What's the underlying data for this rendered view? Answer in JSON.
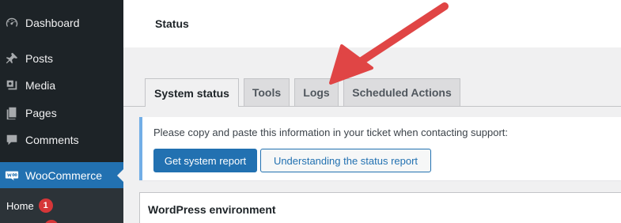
{
  "sidebar": {
    "items": [
      {
        "label": "Dashboard",
        "icon": "dashboard-icon"
      },
      {
        "label": "Posts",
        "icon": "pin-icon"
      },
      {
        "label": "Media",
        "icon": "media-icon"
      },
      {
        "label": "Pages",
        "icon": "pages-icon"
      },
      {
        "label": "Comments",
        "icon": "comment-icon"
      },
      {
        "label": "WooCommerce",
        "icon": "woocommerce-icon",
        "active": true
      }
    ],
    "submenu": {
      "home_label": "Home",
      "home_badge": "1"
    }
  },
  "header": {
    "title": "Status"
  },
  "tabs": [
    {
      "label": "System status",
      "active": true
    },
    {
      "label": "Tools"
    },
    {
      "label": "Logs"
    },
    {
      "label": "Scheduled Actions"
    }
  ],
  "notice": {
    "text": "Please copy and paste this information in your ticket when contacting support:",
    "primary_button": "Get system report",
    "secondary_button": "Understanding the status report"
  },
  "environment": {
    "title": "WordPress environment"
  },
  "colors": {
    "sidebar_bg": "#1d2327",
    "accent": "#2271b1",
    "badge": "#d63638",
    "annotation_arrow": "#e04545"
  }
}
